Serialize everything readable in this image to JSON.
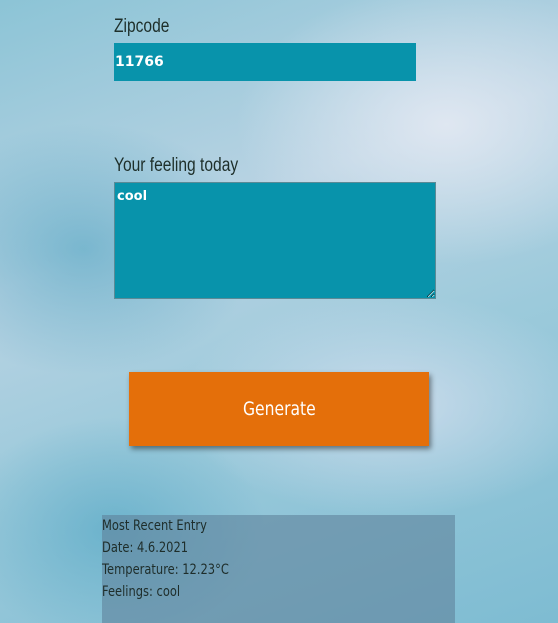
{
  "form": {
    "zip_label": "Zipcode",
    "zip_value": "11766",
    "feeling_label": "Your feeling today",
    "feeling_value": "cool",
    "generate_label": "Generate"
  },
  "entry": {
    "title": "Most Recent Entry",
    "date_prefix": "Date: ",
    "date": "4.6.2021",
    "temp_prefix": "Temperature: ",
    "temp": "12.23°C",
    "feel_prefix": "Feelings: ",
    "feel": "cool"
  },
  "colors": {
    "input_bg": "#0893ab",
    "button_bg": "#e46f0a",
    "text": "#1e2f2a"
  }
}
